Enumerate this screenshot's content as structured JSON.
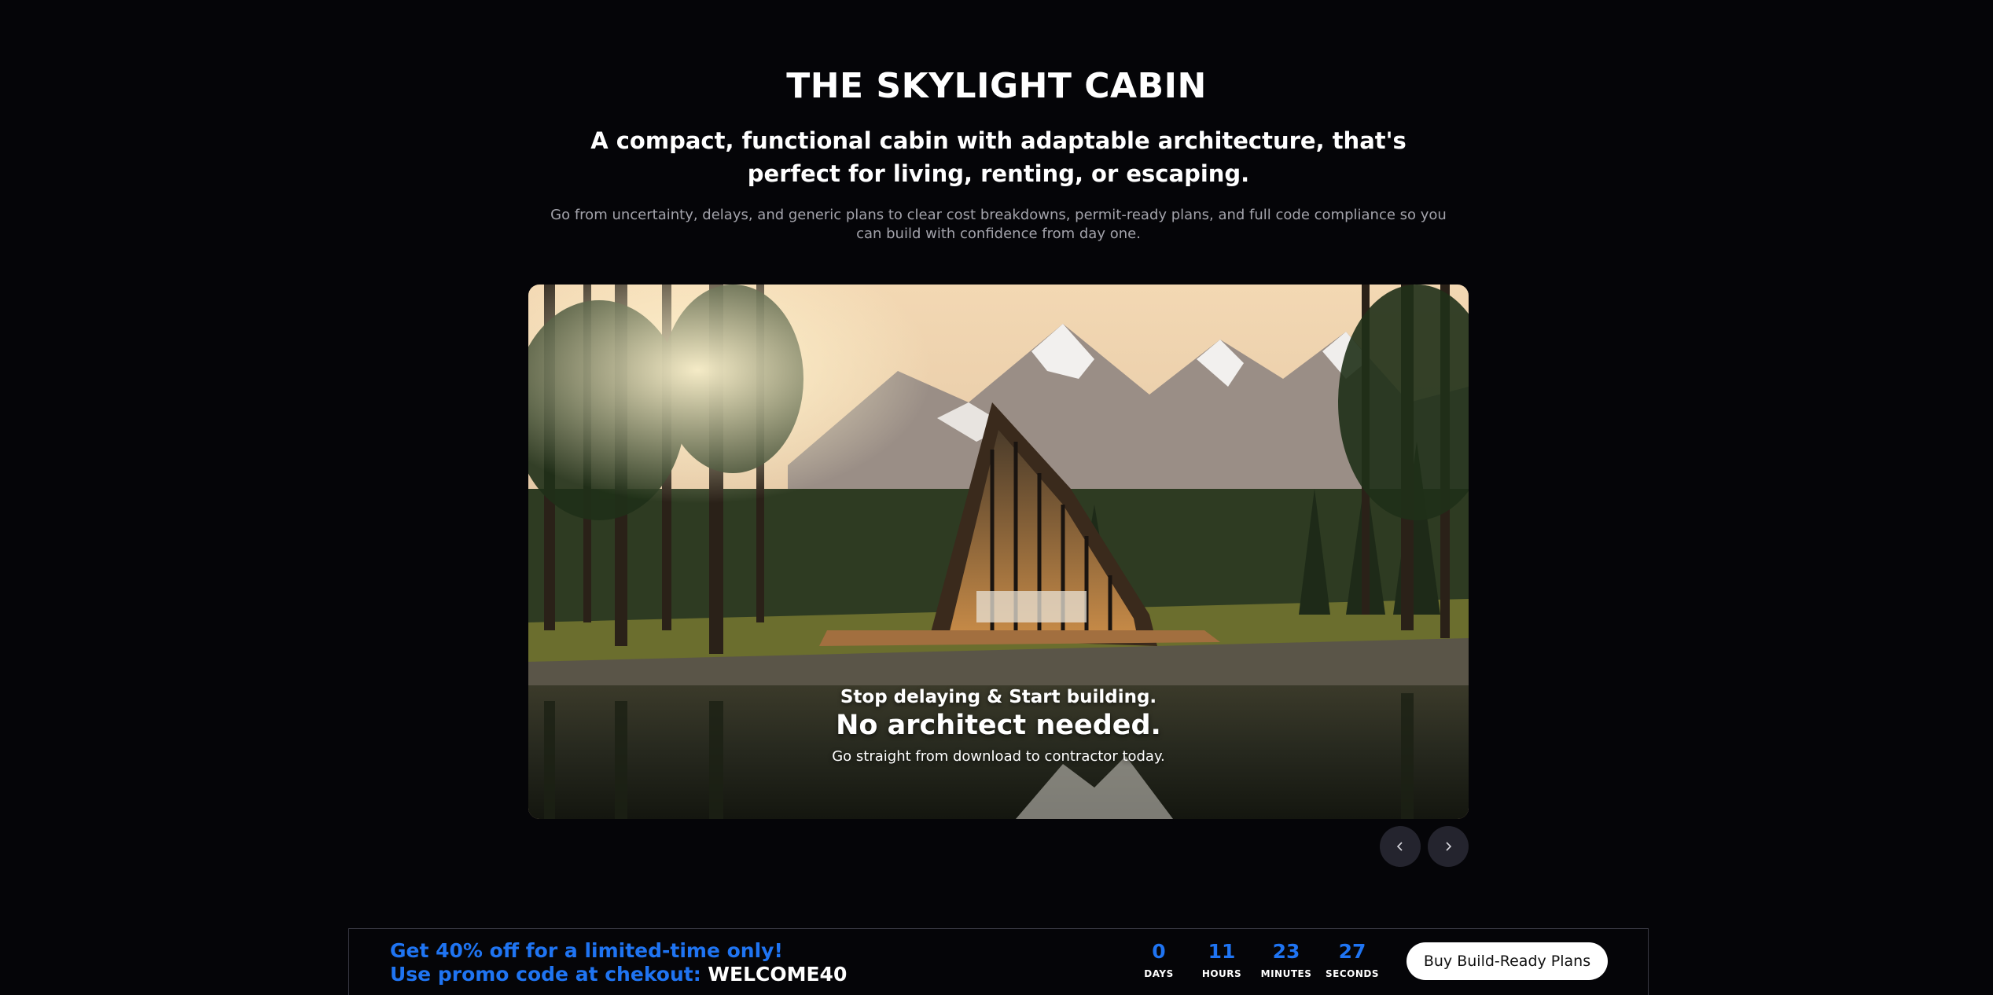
{
  "hero": {
    "title": "THE SKYLIGHT CABIN",
    "subtitle": "A compact, functional cabin with adaptable architecture, that's perfect for living, renting, or escaping.",
    "description": "Go from uncertainty, delays, and generic plans to  clear cost breakdowns, permit-ready plans, and full code compliance so you can build with confidence from day one."
  },
  "carousel": {
    "slide": {
      "tagline": "Stop delaying & Start building.",
      "headline": "No architect needed.",
      "text": "Go straight from download to contractor today."
    },
    "prev_icon": "chevron-left-icon",
    "next_icon": "chevron-right-icon"
  },
  "promo": {
    "line1": "Get 40% off for a limited-time only!",
    "line2_prefix": "Use promo code at chekout:",
    "code": "WELCOME40",
    "countdown": {
      "days": "0",
      "days_label": "DAYS",
      "hours": "11",
      "hours_label": "HOURS",
      "minutes": "23",
      "minutes_label": "MINUTES",
      "seconds": "27",
      "seconds_label": "SECONDS"
    },
    "button_label": "Buy Build-Ready Plans"
  },
  "colors": {
    "background": "#050508",
    "accent": "#1f74f2",
    "muted_text": "#a3a3ab"
  }
}
